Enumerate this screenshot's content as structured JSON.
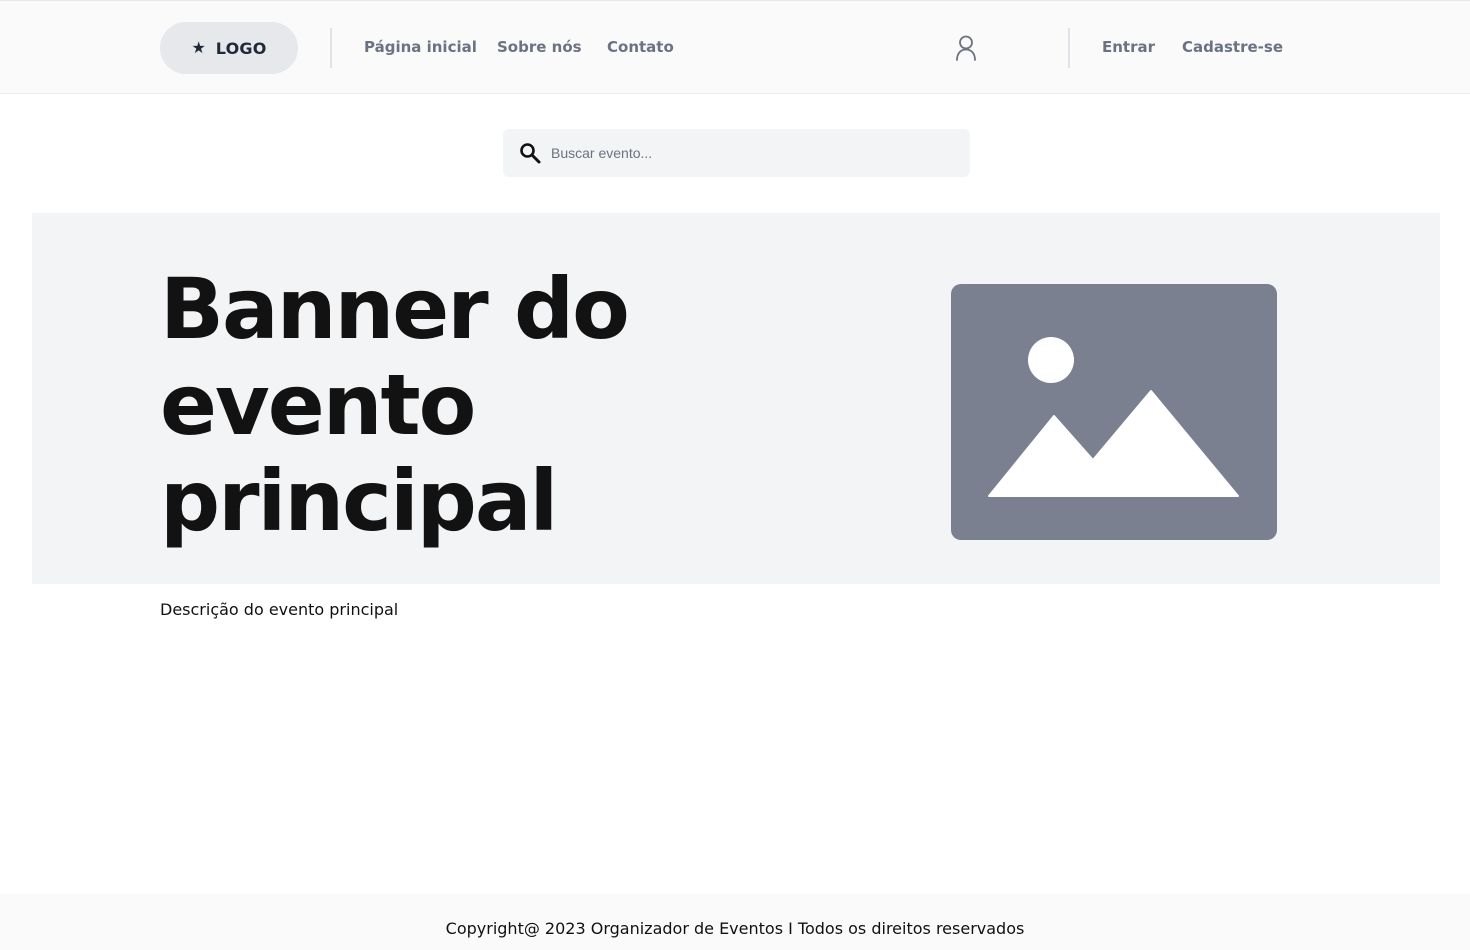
{
  "header": {
    "logo_label": "LOGO",
    "logo_icon": "star-icon",
    "nav": [
      {
        "label": "Página inicial"
      },
      {
        "label": "Sobre nós"
      },
      {
        "label": "Contato"
      }
    ],
    "user_icon": "user-icon",
    "auth": {
      "login_label": "Entrar",
      "signup_label": "Cadastre-se"
    }
  },
  "search": {
    "placeholder": "Buscar evento...",
    "value": "",
    "icon": "search-icon"
  },
  "banner": {
    "title": "Banner do evento principal",
    "image_icon": "image-placeholder-icon"
  },
  "main": {
    "description": "Descrição do evento principal"
  },
  "footer": {
    "copyright": "Copyright@ 2023 Organizador de Eventos I Todos os direitos reservados"
  },
  "colors": {
    "header_bg": "#fafafa",
    "logo_pill_bg": "#e6e8ec",
    "nav_text": "#6b7280",
    "banner_bg": "#f3f4f6",
    "image_placeholder": "#7a8090",
    "title_text": "#121212"
  }
}
